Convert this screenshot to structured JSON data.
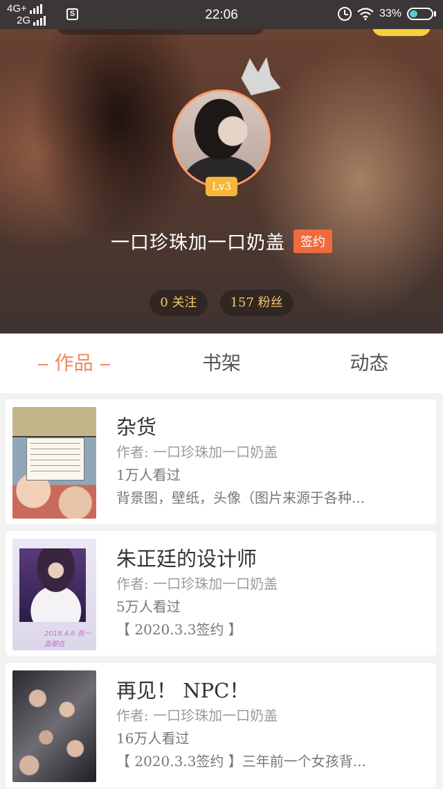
{
  "status_bar": {
    "network_top": "4G+",
    "network_bottom": "2G",
    "sim_icon": "S",
    "time": "22:06",
    "battery": "33%"
  },
  "profile": {
    "level": "Lv3",
    "name": "一口珍珠加一口奶盖",
    "sign_badge": "签约",
    "following": "0 关注",
    "followers": "157 粉丝"
  },
  "tabs": [
    {
      "label": "作品",
      "active": true
    },
    {
      "label": "书架",
      "active": false
    },
    {
      "label": "动态",
      "active": false
    }
  ],
  "books": [
    {
      "title": "杂货",
      "author": "作者: 一口珍珠加一口奶盖",
      "views": "1万人看过",
      "desc": "背景图，壁纸，头像（图片来源于各种..."
    },
    {
      "title": "朱正廷的设计师",
      "author": "作者: 一口珍珠加一口奶盖",
      "views": "5万人看过",
      "desc": "【 2020.3.3签约 】",
      "cover_caption": "2018.4.6 我一直都在"
    },
    {
      "title": "再见！ NPC！",
      "author": "作者: 一口珍珠加一口奶盖",
      "views": "16万人看过",
      "desc": "【 2020.3.3签约 】三年前一个女孩背..."
    }
  ],
  "colors": {
    "accent": "#ef8a5c",
    "sign_badge": "#ef6a3d",
    "level_badge": "#f6b63a",
    "stat_text": "#f2c86b"
  },
  "icons": [
    "signal-icon",
    "sim-icon",
    "alarm-icon",
    "wifi-icon",
    "battery-icon",
    "crown-icon"
  ]
}
